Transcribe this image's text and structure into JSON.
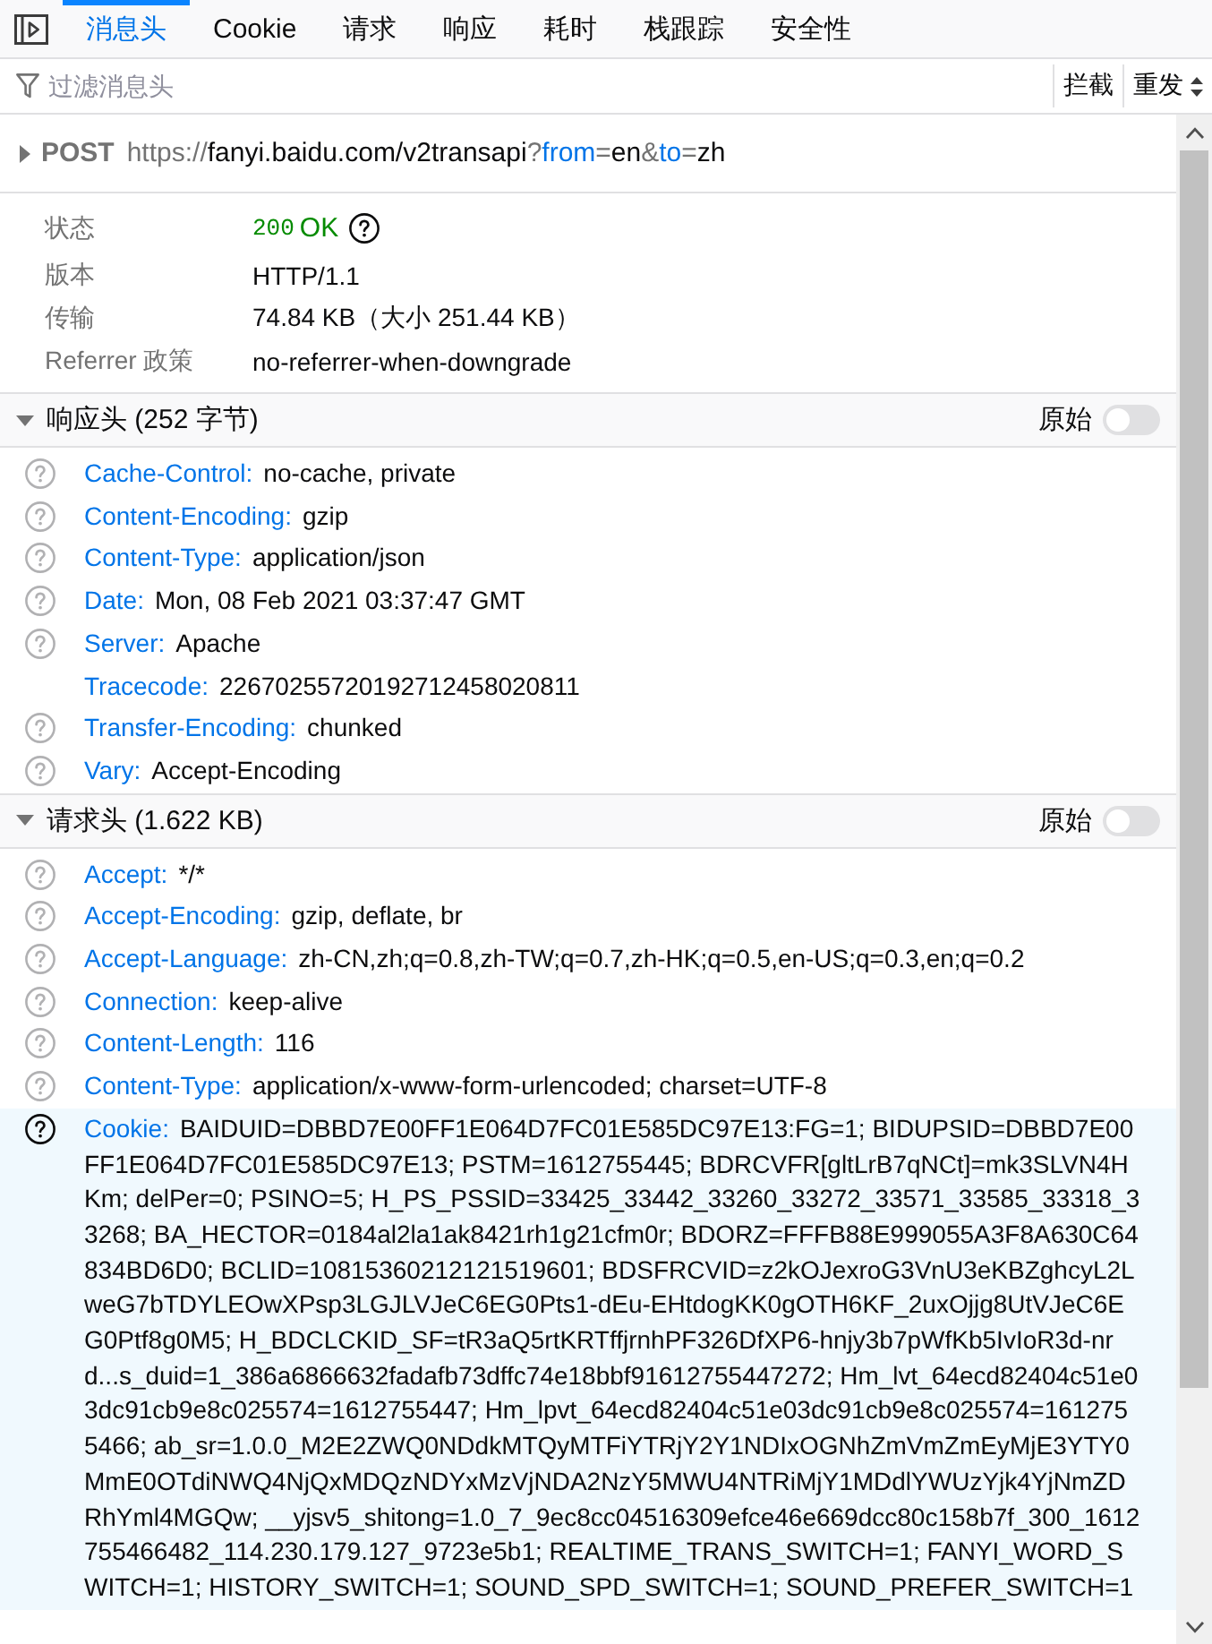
{
  "toolbar": {
    "tabs": [
      {
        "label": "消息头",
        "selected": true
      },
      {
        "label": "Cookie",
        "selected": false
      },
      {
        "label": "请求",
        "selected": false
      },
      {
        "label": "响应",
        "selected": false
      },
      {
        "label": "耗时",
        "selected": false
      },
      {
        "label": "栈跟踪",
        "selected": false
      },
      {
        "label": "安全性",
        "selected": false
      }
    ]
  },
  "filter": {
    "placeholder": "过滤消息头",
    "buttons": [
      {
        "label": "拦截",
        "kind": "plain"
      },
      {
        "label": "重发",
        "kind": "dropdown"
      }
    ]
  },
  "request_line": {
    "expanded": false,
    "method": "POST",
    "url_parts": [
      {
        "kind": "scheme",
        "text": "https://"
      },
      {
        "kind": "host",
        "text": "fanyi.baidu.com/v2transapi"
      },
      {
        "kind": "punct",
        "text": "?"
      },
      {
        "kind": "key",
        "text": "from"
      },
      {
        "kind": "punct",
        "text": "="
      },
      {
        "kind": "value",
        "text": "en"
      },
      {
        "kind": "punct",
        "text": "&"
      },
      {
        "kind": "key",
        "text": "to"
      },
      {
        "kind": "punct",
        "text": "="
      },
      {
        "kind": "value",
        "text": "zh"
      }
    ]
  },
  "summary": [
    {
      "label": "状态",
      "kind": "status",
      "code": "200",
      "text": "OK"
    },
    {
      "label": "版本",
      "kind": "text",
      "value": "HTTP/1.1"
    },
    {
      "label": "传输",
      "kind": "text",
      "value": "74.84 KB（大小 251.44 KB）"
    },
    {
      "label": "Referrer 政策",
      "kind": "text",
      "value": "no-referrer-when-downgrade"
    }
  ],
  "sections": [
    {
      "title": "响应头 (252 字节)",
      "expanded": true,
      "raw_label": "原始",
      "raw": false,
      "headers": [
        {
          "name": "Cache-Control:",
          "value": "no-cache, private",
          "help": true,
          "selected": false
        },
        {
          "name": "Content-Encoding:",
          "value": "gzip",
          "help": true,
          "selected": false
        },
        {
          "name": "Content-Type:",
          "value": "application/json",
          "help": true,
          "selected": false
        },
        {
          "name": "Date:",
          "value": "Mon, 08 Feb 2021 03:37:47 GMT",
          "help": true,
          "selected": false
        },
        {
          "name": "Server:",
          "value": "Apache",
          "help": true,
          "selected": false
        },
        {
          "name": "Tracecode:",
          "value": "22670255720192712458020811",
          "help": false,
          "selected": false
        },
        {
          "name": "Transfer-Encoding:",
          "value": "chunked",
          "help": true,
          "selected": false
        },
        {
          "name": "Vary:",
          "value": "Accept-Encoding",
          "help": true,
          "selected": false
        }
      ]
    },
    {
      "title": "请求头 (1.622 KB)",
      "expanded": true,
      "raw_label": "原始",
      "raw": false,
      "headers": [
        {
          "name": "Accept:",
          "value": "*/*",
          "help": true,
          "selected": false
        },
        {
          "name": "Accept-Encoding:",
          "value": "gzip, deflate, br",
          "help": true,
          "selected": false
        },
        {
          "name": "Accept-Language:",
          "value": "zh-CN,zh;q=0.8,zh-TW;q=0.7,zh-HK;q=0.5,en-US;q=0.3,en;q=0.2",
          "help": true,
          "selected": false
        },
        {
          "name": "Connection:",
          "value": "keep-alive",
          "help": true,
          "selected": false
        },
        {
          "name": "Content-Length:",
          "value": "116",
          "help": true,
          "selected": false
        },
        {
          "name": "Content-Type:",
          "value": "application/x-www-form-urlencoded; charset=UTF-8",
          "help": true,
          "selected": false
        },
        {
          "name": "Cookie:",
          "value": "BAIDUID=DBBD7E00FF1E064D7FC01E585DC97E13:FG=1; BIDUPSID=DBBD7E00FF1E064D7FC01E585DC97E13; PSTM=1612755445; BDRCVFR[gltLrB7qNCt]=mk3SLVN4HKm; delPer=0; PSINO=5; H_PS_PSSID=33425_33442_33260_33272_33571_33585_33318_33268; BA_HECTOR=0184al2la1ak8421rh1g21cfm0r; BDORZ=FFFB88E999055A3F8A630C64834BD6D0; BCLID=10815360212121519601; BDSFRCVID=z2kOJexroG3VnU3eKBZghcyL2LweG7bTDYLEOwXPsp3LGJLVJeC6EG0Pts1-dEu-EHtdogKK0gOTH6KF_2uxOjjg8UtVJeC6EG0Ptf8g0M5; H_BDCLCKID_SF=tR3aQ5rtKRTffjrnhPF326DfXP6-hnjy3b7pWfKb5IvIoR3d-nrd...s_duid=1_386a6866632fadafb73dffc74e18bbf91612755447272; Hm_lvt_64ecd82404c51e03dc91cb9e8c025574=1612755447; Hm_lpvt_64ecd82404c51e03dc91cb9e8c025574=1612755466; ab_sr=1.0.0_M2E2ZWQ0NDdkMTQyMTFiYTRjY2Y1NDIxOGNhZmVmZmEyMjE3YTY0MmE0OTdiNWQ4NjQxMDQzNDYxMzVjNDA2NzY5MWU4NTRiMjY1MDdlYWUzYjk4YjNmZDRhYml4MGQw; __yjsv5_shitong=1.0_7_9ec8cc04516309efce46e669dcc80c158b7f_300_1612755466482_114.230.179.127_9723e5b1; REALTIME_TRANS_SWITCH=1; FANYI_WORD_SWITCH=1; HISTORY_SWITCH=1; SOUND_SPD_SWITCH=1; SOUND_PREFER_SWITCH=1",
          "help": true,
          "selected": true
        }
      ]
    }
  ]
}
